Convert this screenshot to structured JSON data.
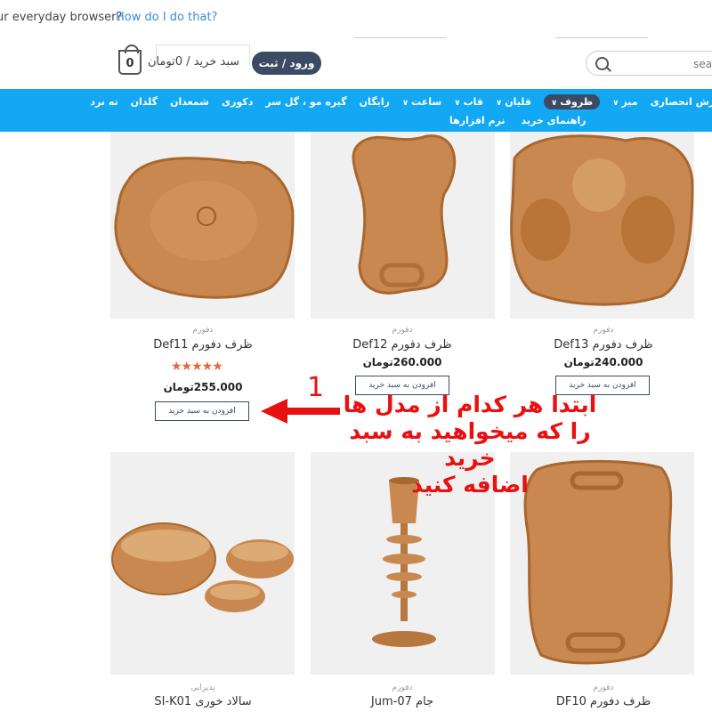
{
  "notice": {
    "text": "ur everyday browser?",
    "link": "How do I do that?"
  },
  "header": {
    "cart_count": "0",
    "cart_text": "سبد خرید / 0تومان",
    "login_label": "ورود / ثبت نام",
    "search_placeholder": "search"
  },
  "nav": {
    "row1": [
      {
        "label": "ته نرد",
        "caret": false
      },
      {
        "label": "گلدان",
        "caret": false
      },
      {
        "label": "شمعدان",
        "caret": false
      },
      {
        "label": "دکوری",
        "caret": false
      },
      {
        "label": "گیره مو ، گل سر",
        "caret": false
      },
      {
        "label": "رایگان",
        "caret": false
      },
      {
        "label": "ساعت",
        "caret": true
      },
      {
        "label": "قاب",
        "caret": true
      },
      {
        "label": "قلیان",
        "caret": true
      },
      {
        "label": "ظروف",
        "caret": true,
        "active": true
      },
      {
        "label": "میز",
        "caret": true
      },
      {
        "label": "سفارش انحصاری",
        "caret": false
      }
    ],
    "row2": [
      "نرم افزارها",
      "راهنمای خرید"
    ]
  },
  "products": [
    {
      "category": "دفورم",
      "name": "ظرف دفورم Def11",
      "price": "255.000تومان",
      "rating": 5,
      "add_label": "افزودن به سبد خرید"
    },
    {
      "category": "دفورم",
      "name": "ظرف دفورم Def12",
      "price": "260.000تومان",
      "add_label": "افزودن به سبد خرید"
    },
    {
      "category": "دفورم",
      "name": "ظرف دفورم Def13",
      "price": "240.000تومان",
      "add_label": "افزودن به سبد خرید"
    },
    {
      "category": "پذیرایی",
      "name": "سالاد خوری SI-K01"
    },
    {
      "category": "دفورم",
      "name": "جام Jum-07"
    },
    {
      "category": "دفورم",
      "name": "ظرف دفورم DF10"
    }
  ],
  "annotation": {
    "number": "1",
    "line1": "ابتدا هر کدام از مدل ها",
    "line2": "را که میخواهید به سبد خرید",
    "line3": "اضافه کنید"
  },
  "colors": {
    "nav_bg": "#13a8f4",
    "dark_button": "#3c4a63",
    "annotation_red": "#e81010",
    "star": "#e4673d"
  }
}
